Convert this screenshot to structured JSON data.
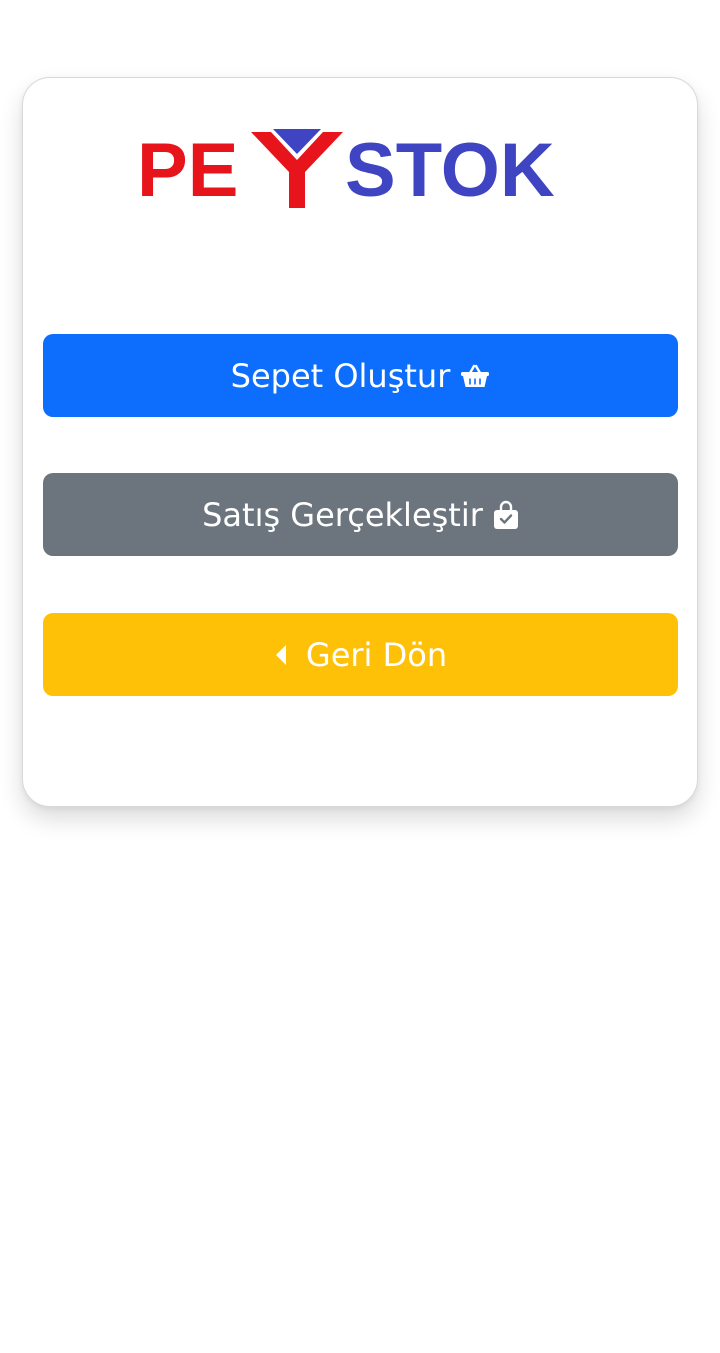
{
  "logo": {
    "text_left": "PE",
    "text_y": "Y",
    "text_right": "STOK",
    "colors": {
      "red": "#e8141b",
      "blue": "#3e44c2"
    }
  },
  "buttons": {
    "create_cart": {
      "label": "Sepet Oluştur",
      "icon": "basket-icon",
      "color": "#0d6efd"
    },
    "make_sale": {
      "label": "Satış Gerçekleştir",
      "icon": "shopping-bag-check-icon",
      "color": "#6c757d"
    },
    "go_back": {
      "label": "Geri Dön",
      "icon": "caret-left-icon",
      "color": "#ffc107"
    }
  }
}
